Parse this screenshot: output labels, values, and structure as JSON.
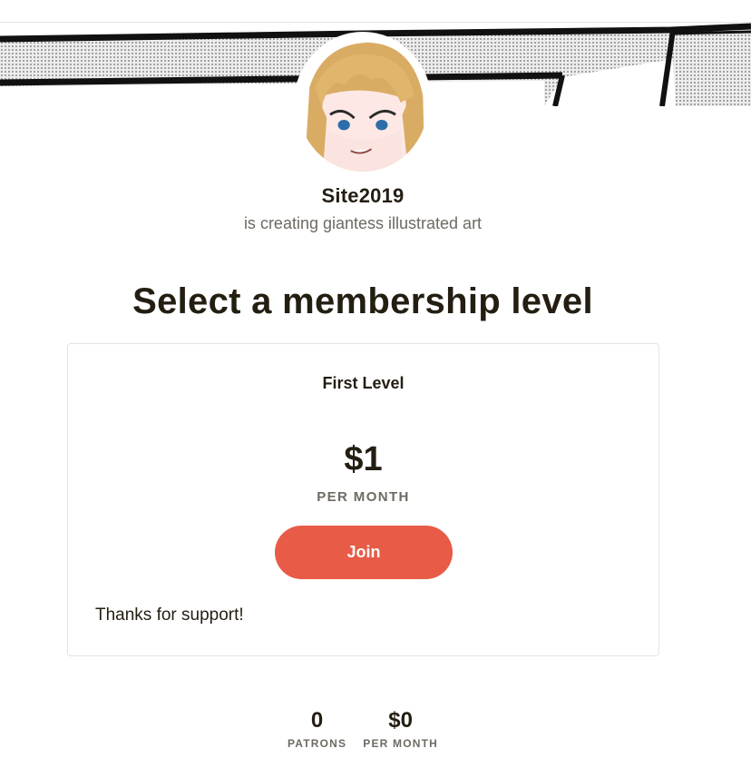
{
  "creator": {
    "name": "Site2019",
    "tagline": "is creating giantess illustrated art"
  },
  "page": {
    "title": "Select a membership level"
  },
  "tier": {
    "name": "First Level",
    "price": "$1",
    "period": "PER MONTH",
    "join_label": "Join",
    "description": "Thanks for support!"
  },
  "stats": {
    "patrons_value": "0",
    "patrons_label": "PATRONS",
    "earnings_value": "$0",
    "earnings_label": "PER MONTH"
  },
  "colors": {
    "accent": "#e85b46",
    "text": "#241e12",
    "muted": "#6e6a63",
    "border": "#e5e3dd"
  },
  "icons": {
    "cover": "manga-panel-cover-image",
    "avatar": "anime-girl-avatar-image"
  }
}
